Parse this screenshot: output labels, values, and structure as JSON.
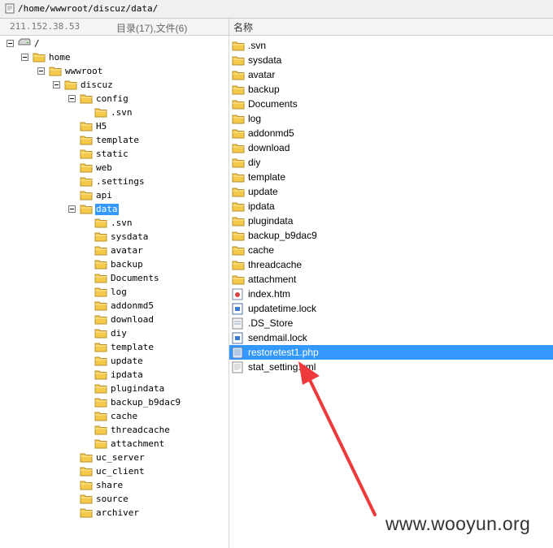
{
  "address_bar": {
    "path": "/home/wwwroot/discuz/data/"
  },
  "header": {
    "server_ip": "211.152.38.53",
    "counts": "目录(17),文件(6)",
    "name_column": "名称"
  },
  "tree": [
    {
      "label": "/",
      "level": 0,
      "expanded": true,
      "type": "drive"
    },
    {
      "label": "home",
      "level": 1,
      "expanded": true
    },
    {
      "label": "wwwroot",
      "level": 2,
      "expanded": true
    },
    {
      "label": "discuz",
      "level": 3,
      "expanded": true
    },
    {
      "label": "config",
      "level": 4,
      "expanded": true
    },
    {
      "label": ".svn",
      "level": 5
    },
    {
      "label": "H5",
      "level": 4
    },
    {
      "label": "template",
      "level": 4
    },
    {
      "label": "static",
      "level": 4
    },
    {
      "label": "web",
      "level": 4
    },
    {
      "label": ".settings",
      "level": 4
    },
    {
      "label": "api",
      "level": 4
    },
    {
      "label": "data",
      "level": 4,
      "expanded": true,
      "selected": true
    },
    {
      "label": ".svn",
      "level": 5
    },
    {
      "label": "sysdata",
      "level": 5
    },
    {
      "label": "avatar",
      "level": 5
    },
    {
      "label": "backup",
      "level": 5
    },
    {
      "label": "Documents",
      "level": 5
    },
    {
      "label": "log",
      "level": 5
    },
    {
      "label": "addonmd5",
      "level": 5
    },
    {
      "label": "download",
      "level": 5
    },
    {
      "label": "diy",
      "level": 5
    },
    {
      "label": "template",
      "level": 5
    },
    {
      "label": "update",
      "level": 5
    },
    {
      "label": "ipdata",
      "level": 5
    },
    {
      "label": "plugindata",
      "level": 5
    },
    {
      "label": "backup_b9dac9",
      "level": 5
    },
    {
      "label": "cache",
      "level": 5
    },
    {
      "label": "threadcache",
      "level": 5
    },
    {
      "label": "attachment",
      "level": 5
    },
    {
      "label": "uc_server",
      "level": 4
    },
    {
      "label": "uc_client",
      "level": 4
    },
    {
      "label": "share",
      "level": 4
    },
    {
      "label": "source",
      "level": 4
    },
    {
      "label": "archiver",
      "level": 4
    }
  ],
  "files": [
    {
      "name": ".svn",
      "icon": "folder-icon"
    },
    {
      "name": "sysdata",
      "icon": "folder-icon"
    },
    {
      "name": "avatar",
      "icon": "folder-icon"
    },
    {
      "name": "backup",
      "icon": "folder-icon"
    },
    {
      "name": "Documents",
      "icon": "folder-icon"
    },
    {
      "name": "log",
      "icon": "folder-icon"
    },
    {
      "name": "addonmd5",
      "icon": "folder-icon"
    },
    {
      "name": "download",
      "icon": "folder-icon"
    },
    {
      "name": "diy",
      "icon": "folder-icon"
    },
    {
      "name": "template",
      "icon": "folder-icon"
    },
    {
      "name": "update",
      "icon": "folder-icon"
    },
    {
      "name": "ipdata",
      "icon": "folder-icon"
    },
    {
      "name": "plugindata",
      "icon": "folder-icon"
    },
    {
      "name": "backup_b9dac9",
      "icon": "folder-icon"
    },
    {
      "name": "cache",
      "icon": "folder-icon"
    },
    {
      "name": "threadcache",
      "icon": "folder-icon"
    },
    {
      "name": "attachment",
      "icon": "folder-icon"
    },
    {
      "name": "index.htm",
      "icon": "html-file-icon"
    },
    {
      "name": "updatetime.lock",
      "icon": "lock-file-icon"
    },
    {
      "name": ".DS_Store",
      "icon": "generic-file-icon"
    },
    {
      "name": "sendmail.lock",
      "icon": "lock-file-icon"
    },
    {
      "name": "restoretest1.php",
      "icon": "php-file-icon",
      "selected": true
    },
    {
      "name": "stat_setting.xml",
      "icon": "text-file-icon"
    }
  ],
  "watermark": "www.wooyun.org",
  "colors": {
    "selection": "#3399ff",
    "folder": "#f5c94a",
    "arrow": "#ee3a3a"
  }
}
